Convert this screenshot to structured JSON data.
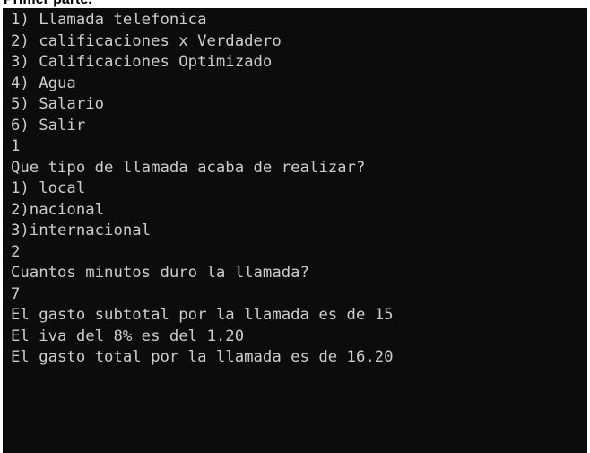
{
  "heading": "Primer parte.",
  "console": {
    "lines": [
      "1) Llamada telefonica",
      "2) calificaciones x Verdadero",
      "3) Calificaciones Optimizado",
      "4) Agua",
      "5) Salario",
      "6) Salir",
      "1",
      "Que tipo de llamada acaba de realizar?",
      "1) local",
      "2)nacional",
      "3)internacional",
      "2",
      "Cuantos minutos duro la llamada?",
      "7",
      "El gasto subtotal por la llamada es de 15",
      "El iva del 8% es del 1.20",
      "El gasto total por la llamada es de 16.20"
    ]
  },
  "colors": {
    "console_background": "#0c0c0c",
    "console_text": "#cccccc",
    "page_background": "#ffffff",
    "heading_text": "#000000"
  }
}
